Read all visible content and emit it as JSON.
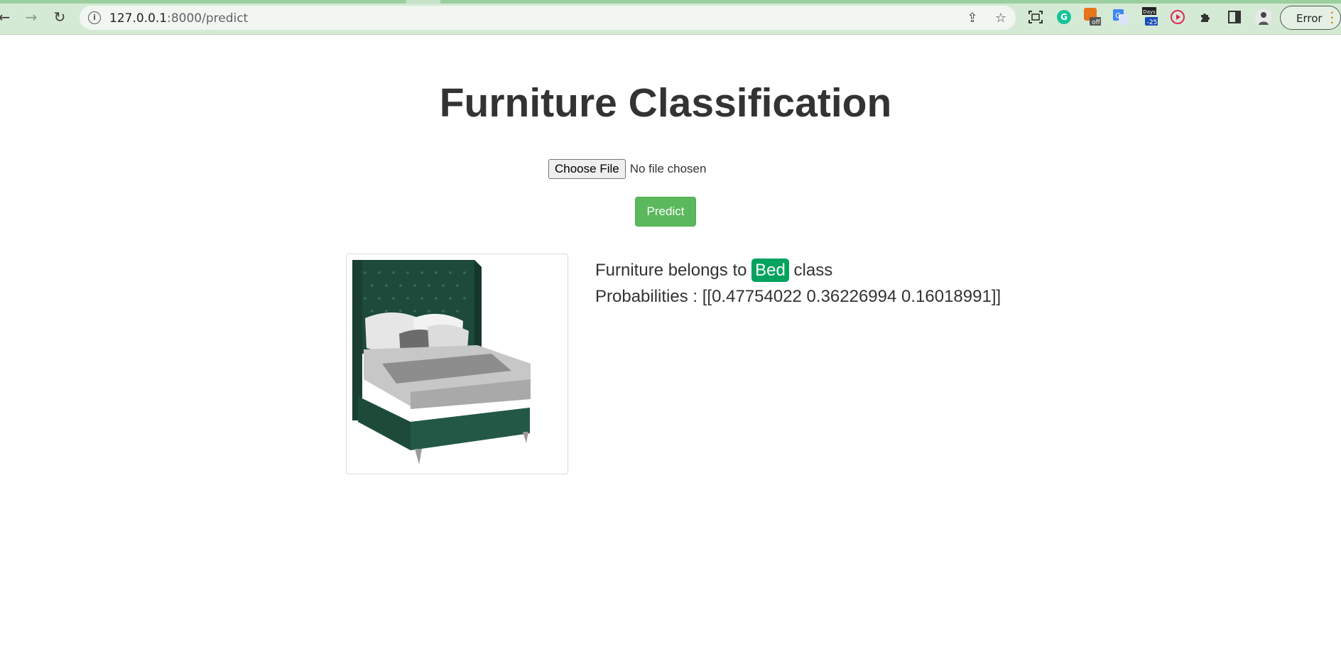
{
  "browser": {
    "url_host": "127.0.0.1",
    "url_rest": ":8000/predict",
    "profile_label": "Error",
    "extensions": [
      "grammarly-icon",
      "off-extension-icon",
      "google-translate-icon",
      "days-counter-icon",
      "video-play-icon",
      "puzzle-extensions-icon",
      "side-panel-icon"
    ],
    "days_badge_top": "Days",
    "days_badge_bottom": "-25",
    "off_badge": "off"
  },
  "page": {
    "title": "Furniture Classification",
    "choose_file_label": "Choose File",
    "no_file_label": "No file chosen",
    "predict_label": "Predict"
  },
  "result": {
    "prefix": "Furniture belongs to",
    "class_name": "Bed",
    "suffix": "class",
    "probabilities_label": "Probabilities :",
    "probabilities_value": "[[0.47754022 0.36226994 0.16018991]]"
  },
  "colors": {
    "predict_button": "#5cb85c",
    "class_badge": "#02a35e",
    "chrome_bar": "#d4ead5"
  }
}
